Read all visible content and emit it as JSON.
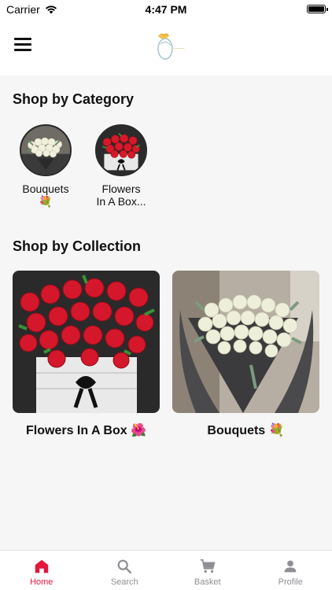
{
  "status_bar": {
    "carrier": "Carrier",
    "time": "4:47 PM",
    "icons": [
      "wifi-icon",
      "battery-icon"
    ]
  },
  "header": {
    "menu_icon": "hamburger-menu-icon",
    "logo": "brand-logo"
  },
  "categories_section": {
    "title": "Shop by Category",
    "items": [
      {
        "label": "Bouquets 💐",
        "image": "white-roses-bouquet"
      },
      {
        "label": "Flowers In A Box...",
        "image": "red-roses-box"
      }
    ]
  },
  "collections_section": {
    "title": "Shop by Collection",
    "items": [
      {
        "label": "Flowers In A Box 🌺",
        "image": "red-roses-box"
      },
      {
        "label": "Bouquets 💐",
        "image": "white-roses-bouquet"
      }
    ]
  },
  "tabbar": {
    "items": [
      {
        "label": "Home",
        "icon": "home-icon",
        "active": true
      },
      {
        "label": "Search",
        "icon": "search-icon",
        "active": false
      },
      {
        "label": "Basket",
        "icon": "cart-icon",
        "active": false
      },
      {
        "label": "Profile",
        "icon": "person-icon",
        "active": false
      }
    ]
  },
  "colors": {
    "accent": "#e3173e",
    "inactive": "#8e8e93",
    "background": "#f6f6f6"
  }
}
